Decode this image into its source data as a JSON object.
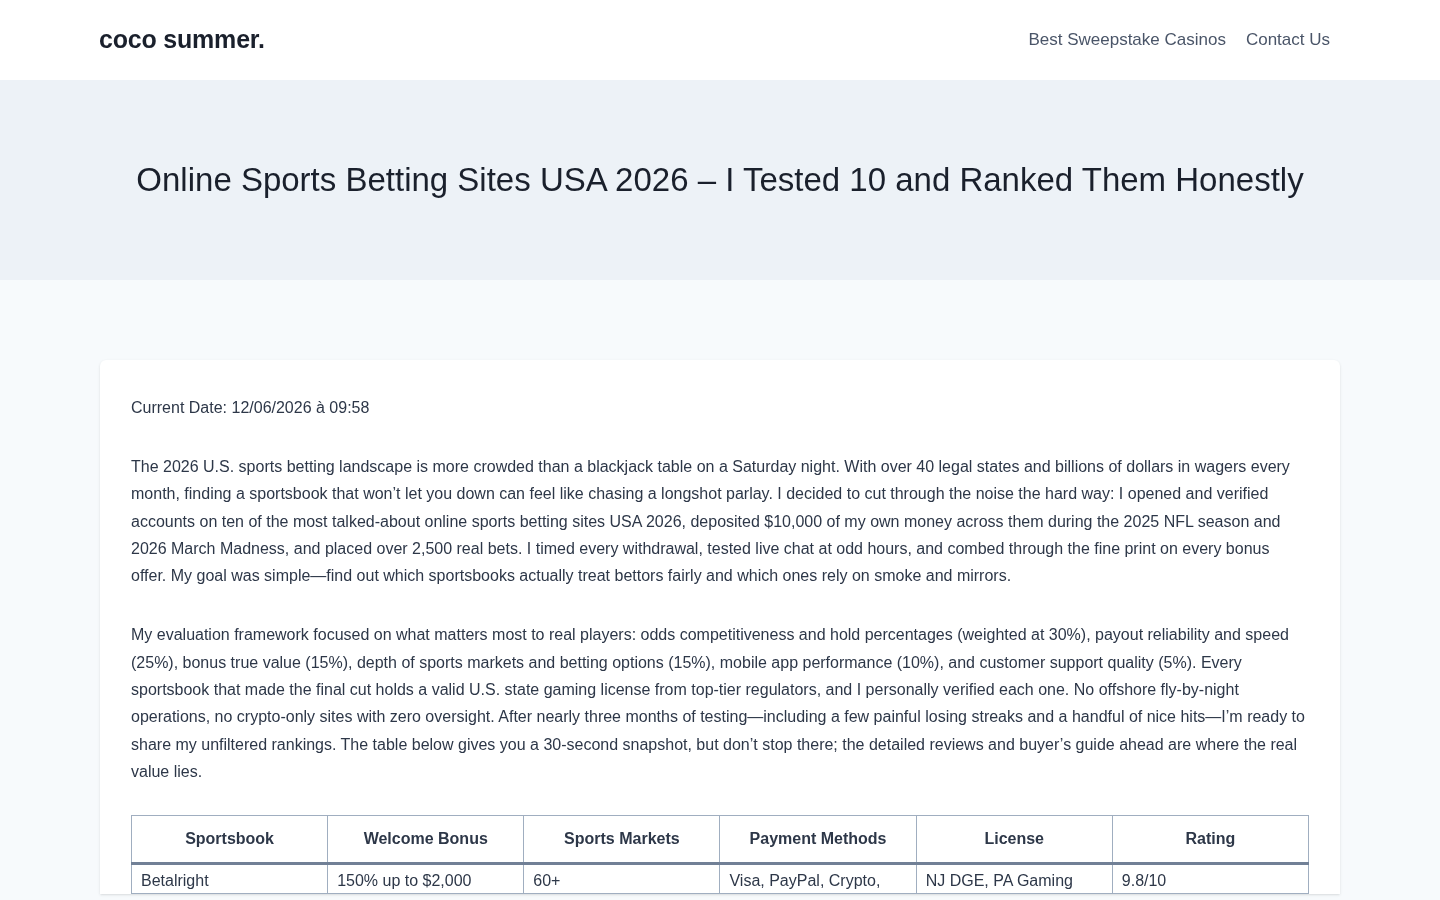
{
  "header": {
    "logo": "coco summer.",
    "nav": [
      {
        "label": "Best Sweepstake Casinos"
      },
      {
        "label": "Contact Us"
      }
    ]
  },
  "hero": {
    "title": "Online Sports Betting Sites USA 2026 – I Tested 10 and Ranked Them Honestly"
  },
  "article": {
    "date": "Current Date: 12/06/2026 à 09:58",
    "paragraphs": [
      "The 2026 U.S. sports betting landscape is more crowded than a blackjack table on a Saturday night. With over 40 legal states and billions of dollars in wagers every month, finding a sportsbook that won’t let you down can feel like chasing a longshot parlay. I decided to cut through the noise the hard way: I opened and verified accounts on ten of the most talked-about online sports betting sites USA 2026, deposited $10,000 of my own money across them during the 2025 NFL season and 2026 March Madness, and placed over 2,500 real bets. I timed every withdrawal, tested live chat at odd hours, and combed through the fine print on every bonus offer. My goal was simple—find out which sportsbooks actually treat bettors fairly and which ones rely on smoke and mirrors.",
      "My evaluation framework focused on what matters most to real players: odds competitiveness and hold percentages (weighted at 30%), payout reliability and speed (25%), bonus true value (15%), depth of sports markets and betting options (15%), mobile app performance (10%), and customer support quality (5%). Every sportsbook that made the final cut holds a valid U.S. state gaming license from top-tier regulators, and I personally verified each one. No offshore fly-by-night operations, no crypto-only sites with zero oversight. After nearly three months of testing—including a few painful losing streaks and a handful of nice hits—I’m ready to share my unfiltered rankings. The table below gives you a 30-second snapshot, but don’t stop there; the detailed reviews and buyer’s guide ahead are where the real value lies."
    ],
    "table": {
      "columns": [
        "Sportsbook",
        "Welcome Bonus",
        "Sports Markets",
        "Payment Methods",
        "License",
        "Rating"
      ],
      "rows": [
        [
          "Betalright",
          "150% up to $2,000",
          "60+",
          "Visa, PayPal, Crypto,",
          "NJ DGE, PA Gaming",
          "9.8/10"
        ]
      ]
    }
  }
}
